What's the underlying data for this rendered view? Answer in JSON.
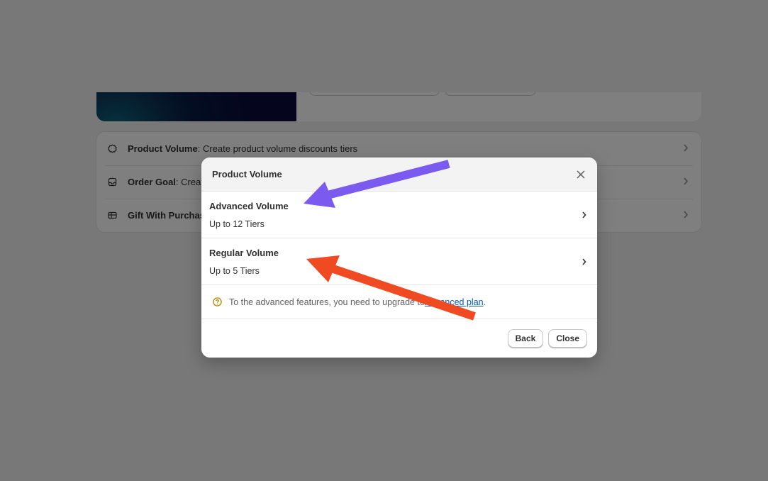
{
  "list": {
    "rows": [
      {
        "title": "Product Volume",
        "desc": ": Create product volume discounts tiers",
        "icon": "discount-tag-icon"
      },
      {
        "title": "Order Goal",
        "desc": ": Create",
        "icon": "order-box-icon"
      },
      {
        "title": "Gift With Purchas",
        "desc": "",
        "icon": "gift-card-icon"
      }
    ]
  },
  "modal": {
    "title": "Product Volume",
    "options": [
      {
        "title": "Advanced Volume",
        "subtitle": "Up to 12 Tiers"
      },
      {
        "title": "Regular Volume",
        "subtitle": "Up to 5 Tiers"
      }
    ],
    "notice": {
      "text": "To the advanced features, you need to upgrade to ",
      "link": "Advanced plan",
      "suffix": "."
    },
    "buttons": {
      "back": "Back",
      "close": "Close"
    }
  },
  "colors": {
    "arrow_purple": "#7b5af0",
    "arrow_red": "#f04a23",
    "link": "#005bd3"
  }
}
